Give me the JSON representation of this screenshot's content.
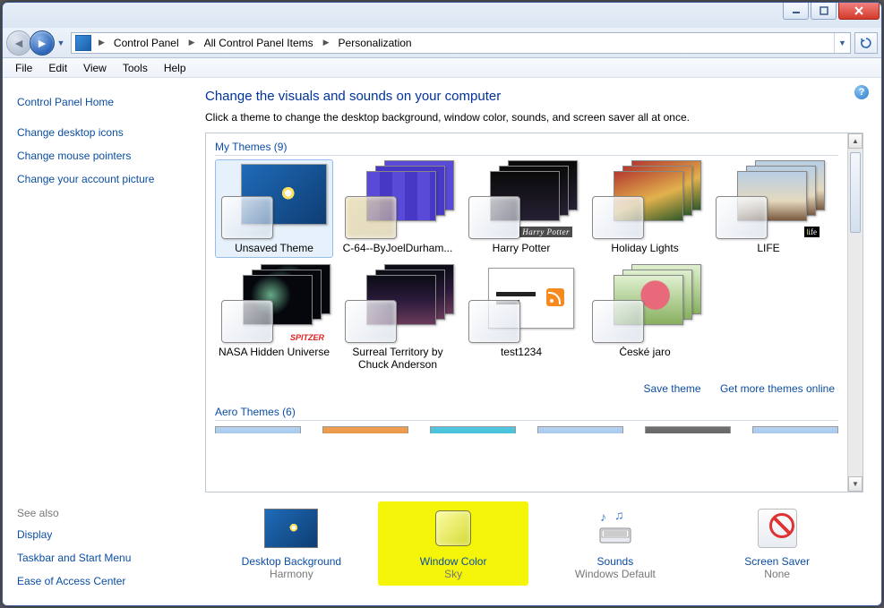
{
  "breadcrumb": {
    "seg1": "Control Panel",
    "seg2": "All Control Panel Items",
    "seg3": "Personalization"
  },
  "menu": {
    "file": "File",
    "edit": "Edit",
    "view": "View",
    "tools": "Tools",
    "help": "Help"
  },
  "sidebar": {
    "home": "Control Panel Home",
    "links": [
      "Change desktop icons",
      "Change mouse pointers",
      "Change your account picture"
    ],
    "seealso_head": "See also",
    "seealso": [
      "Display",
      "Taskbar and Start Menu",
      "Ease of Access Center"
    ]
  },
  "main": {
    "title": "Change the visuals and sounds on your computer",
    "subtitle": "Click a theme to change the desktop background, window color, sounds, and screen saver all at once.",
    "mythemes_head": "My Themes (9)",
    "aero_head": "Aero Themes (6)",
    "save_link": "Save theme",
    "more_link": "Get more themes online",
    "themes": [
      {
        "label": "Unsaved Theme"
      },
      {
        "label": "C-64--ByJoelDurham..."
      },
      {
        "label": "Harry Potter"
      },
      {
        "label": "Holiday Lights"
      },
      {
        "label": "LIFE"
      },
      {
        "label": "NASA Hidden Universe"
      },
      {
        "label": "Surreal Territory by Chuck Anderson"
      },
      {
        "label": "test1234"
      },
      {
        "label": "České jaro"
      }
    ]
  },
  "bottom": {
    "desktop": {
      "title": "Desktop Background",
      "value": "Harmony"
    },
    "color": {
      "title": "Window Color",
      "value": "Sky"
    },
    "sounds": {
      "title": "Sounds",
      "value": "Windows Default"
    },
    "saver": {
      "title": "Screen Saver",
      "value": "None"
    }
  }
}
